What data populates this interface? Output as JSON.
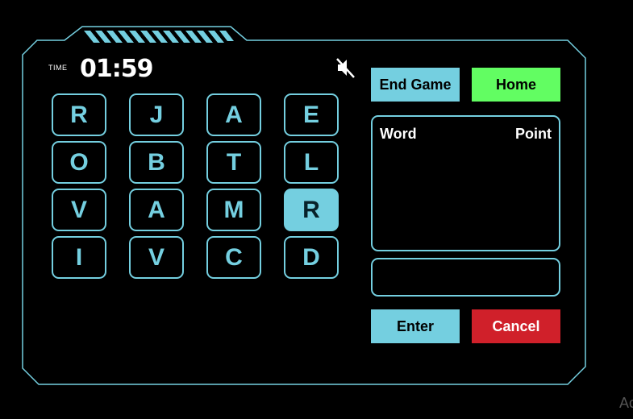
{
  "timer": {
    "label": "TIME",
    "value": "01:59"
  },
  "icons": {
    "sound": "speaker-muted-icon"
  },
  "grid": {
    "rows": [
      [
        "R",
        "J",
        "A",
        "E"
      ],
      [
        "O",
        "B",
        "T",
        "L"
      ],
      [
        "V",
        "A",
        "M",
        "R"
      ],
      [
        "I",
        "V",
        "C",
        "D"
      ]
    ],
    "selected": [
      [
        2,
        3
      ]
    ]
  },
  "buttons": {
    "end_game": "End Game",
    "home": "Home",
    "enter": "Enter",
    "cancel": "Cancel"
  },
  "score_panel": {
    "word_header": "Word",
    "point_header": "Point",
    "entries": []
  },
  "input": {
    "value": "",
    "placeholder": ""
  },
  "corner_text": "Ac",
  "colors": {
    "accent": "#74cfe0",
    "home": "#62fd62",
    "cancel": "#d0202a",
    "background": "#000000"
  }
}
